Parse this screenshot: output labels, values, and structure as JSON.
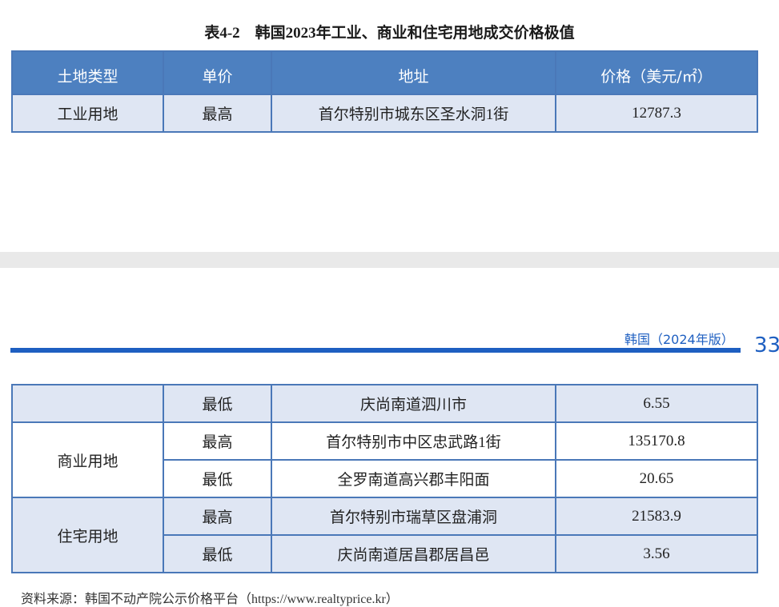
{
  "title": "表4-2　韩国2023年工业、商业和住宅用地成交价格极值",
  "table_top": {
    "headers": [
      "土地类型",
      "单价",
      "地址",
      "价格（美元/㎡）"
    ],
    "rows": [
      {
        "type": "工业用地",
        "unit": "最高",
        "address": "首尔特别市城东区圣水洞1街",
        "price": "12787.3"
      }
    ]
  },
  "running_header": {
    "text": "韩国（2024年版）",
    "page_number": "33"
  },
  "table_bottom": {
    "rows": [
      {
        "type": "",
        "unit": "最低",
        "address": "庆尚南道泗川市",
        "price": "6.55"
      },
      {
        "type": "商业用地",
        "unit": "最高",
        "address": "首尔特别市中区忠武路1街",
        "price": "135170.8"
      },
      {
        "unit": "最低",
        "address": "全罗南道高兴郡丰阳面",
        "price": "20.65"
      },
      {
        "type": "住宅用地",
        "unit": "最高",
        "address": "首尔特别市瑞草区盘浦洞",
        "price": "21583.9"
      },
      {
        "unit": "最低",
        "address": "庆尚南道居昌郡居昌邑",
        "price": "3.56"
      }
    ]
  },
  "source": "资料来源：韩国不动产院公示价格平台（https://www.realtyprice.kr）"
}
